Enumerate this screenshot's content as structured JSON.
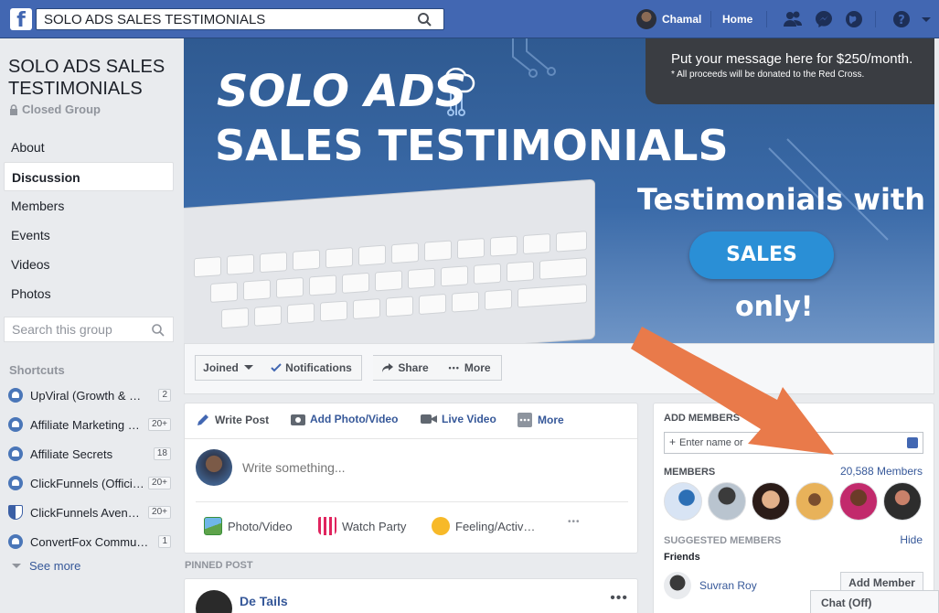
{
  "topbar": {
    "search_value": "SOLO ADS SALES TESTIMONIALS",
    "user_name": "Chamal",
    "home_label": "Home"
  },
  "group": {
    "title": "SOLO ADS SALES TESTIMONIALS",
    "privacy": "Closed Group",
    "nav": [
      "About",
      "Discussion",
      "Members",
      "Events",
      "Videos",
      "Photos"
    ],
    "active_nav": "Discussion",
    "search_placeholder": "Search this group"
  },
  "shortcuts": {
    "title": "Shortcuts",
    "items": [
      {
        "label": "UpViral (Growth & M…",
        "badge": "2"
      },
      {
        "label": "Affiliate Marketing …",
        "badge": "20+"
      },
      {
        "label": "Affiliate Secrets",
        "badge": "18"
      },
      {
        "label": "ClickFunnels (Offici…",
        "badge": "20+"
      },
      {
        "label": "ClickFunnels Aven…",
        "badge": "20+"
      },
      {
        "label": "ConvertFox Commu…",
        "badge": "1"
      }
    ],
    "see_more": "See more"
  },
  "cover": {
    "line1": "SOLO ADS",
    "line2": "SALES TESTIMONIALS",
    "line3": "Testimonials with",
    "button": "SALES",
    "line4": "only!",
    "ad_line1": "Put your message here for $250/month.",
    "ad_line2": "* All proceeds will be donated to the Red Cross."
  },
  "actions": {
    "joined": "Joined",
    "notifications": "Notifications",
    "share": "Share",
    "more": "More"
  },
  "composer": {
    "tabs": [
      "Write Post",
      "Add Photo/Video",
      "Live Video",
      "More"
    ],
    "placeholder": "Write something...",
    "options": [
      "Photo/Video",
      "Watch Party",
      "Feeling/Activ…"
    ],
    "more_dots": "•••"
  },
  "pinned": {
    "label": "PINNED POST",
    "author": "De Tails",
    "menu": "•••"
  },
  "right_panel": {
    "add_members_title": "ADD MEMBERS",
    "add_placeholder": "Enter name or",
    "members_title": "MEMBERS",
    "members_count": "20,588 Members",
    "suggested_title": "SUGGESTED MEMBERS",
    "hide": "Hide",
    "friends_label": "Friends",
    "suggested": [
      {
        "name": "Suvran Roy",
        "button": "Add Member"
      }
    ]
  },
  "chat": {
    "label": "Chat (Off)"
  },
  "colors": {
    "brand": "#4267b2",
    "link": "#365899",
    "arrow": "#e97a4a"
  }
}
